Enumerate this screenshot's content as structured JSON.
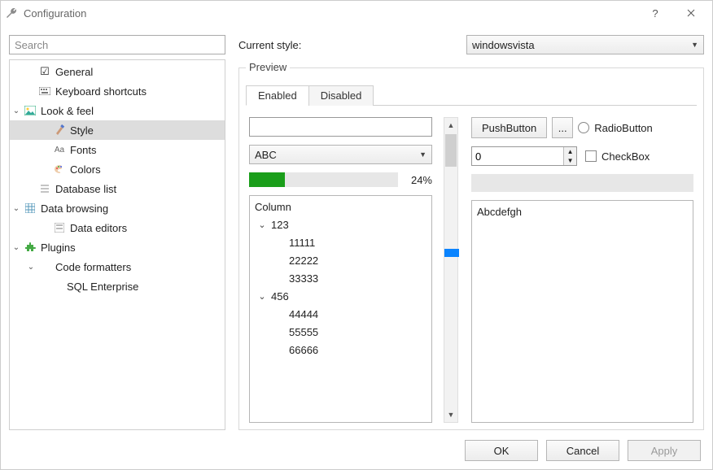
{
  "window": {
    "title": "Configuration"
  },
  "search": {
    "placeholder": "Search"
  },
  "tree": {
    "general": "General",
    "keyboard": "Keyboard shortcuts",
    "look": "Look & feel",
    "style": "Style",
    "fonts": "Fonts",
    "colors": "Colors",
    "dblist": "Database list",
    "browsing": "Data browsing",
    "editors": "Data editors",
    "plugins": "Plugins",
    "formatters": "Code formatters",
    "sql": "SQL Enterprise"
  },
  "style": {
    "label": "Current style:",
    "value": "windowsvista"
  },
  "preview": {
    "title": "Preview",
    "tabs": {
      "enabled": "Enabled",
      "disabled": "Disabled"
    },
    "combo": "ABC",
    "progress": {
      "percent": 24,
      "label": "24%"
    },
    "tree_header": "Column",
    "tree": {
      "g1": "123",
      "g1c1": "11111",
      "g1c2": "22222",
      "g1c3": "33333",
      "g2": "456",
      "g2c1": "44444",
      "g2c2": "55555",
      "g2c3": "66666"
    },
    "pushbutton": "PushButton",
    "morebtn": "...",
    "radio": "RadioButton",
    "spin": "0",
    "checkbox": "CheckBox",
    "textarea": "Abcdefgh"
  },
  "buttons": {
    "ok": "OK",
    "cancel": "Cancel",
    "apply": "Apply"
  }
}
